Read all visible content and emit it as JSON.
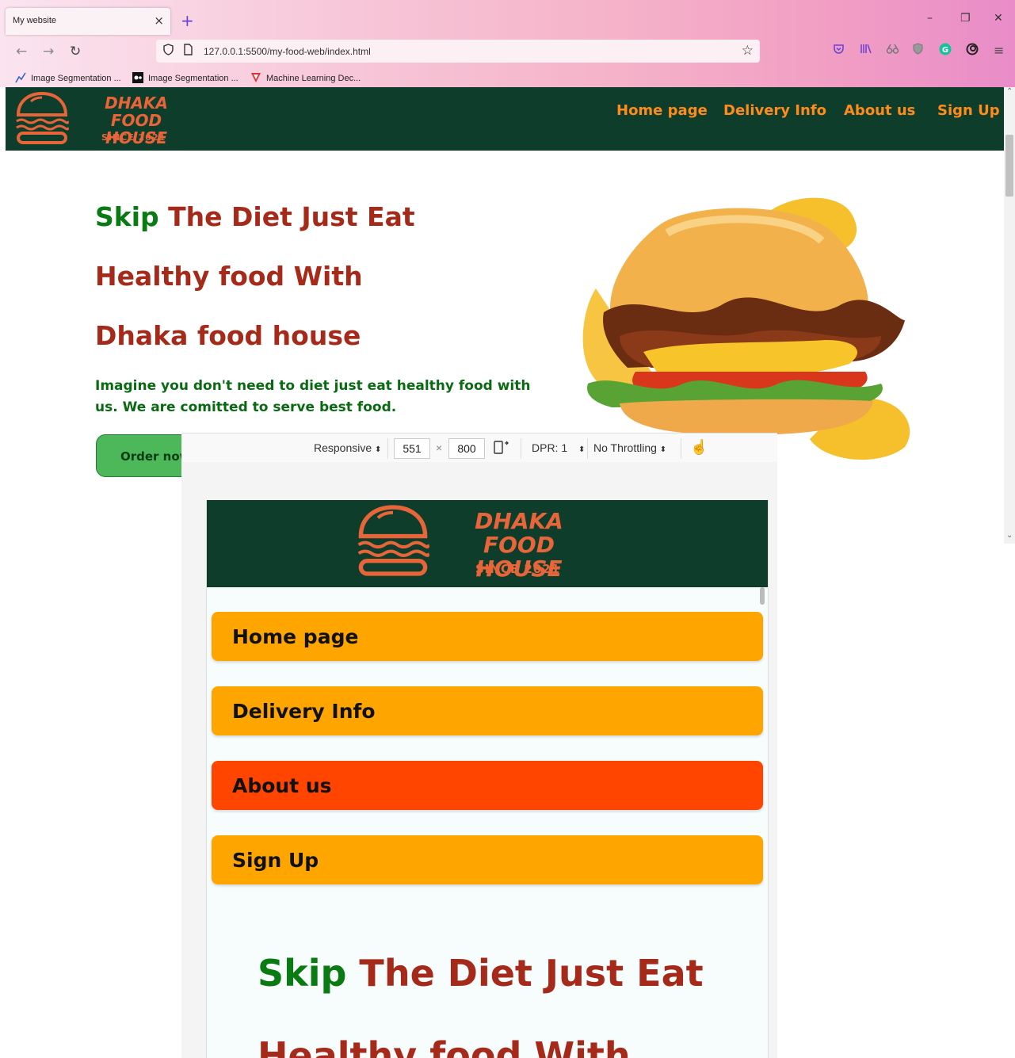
{
  "browser": {
    "tab_title": "My website",
    "tab_close": "×",
    "new_tab": "+",
    "window_controls": {
      "minimize": "–",
      "restore": "❐",
      "close": "✕"
    },
    "url": "127.0.0.1:5500/my-food-web/index.html",
    "bookmarks": [
      {
        "label": "Image Segmentation ...",
        "icon": "chart-line-icon"
      },
      {
        "label": "Image Segmentation ...",
        "icon": "medium-logo-icon"
      },
      {
        "label": "Machine Learning Dec...",
        "icon": "v-logo-icon"
      }
    ]
  },
  "site": {
    "logo": {
      "line1": "DHAKA FOOD",
      "line2": "HOUSE",
      "since": "SINCE 2021"
    },
    "nav": [
      "Home page",
      "Delivery Info",
      "About us",
      "Sign Up"
    ],
    "hero": {
      "heading1_green": "Skip",
      "heading1_rest": " The Diet Just Eat",
      "heading2": "Healthy food With",
      "heading3": "Dhaka food house",
      "paragraph": "Imagine you don't need to diet just eat healthy food with us. We are comitted to serve best food.",
      "order_button": "Order now"
    },
    "colors": {
      "header_bg": "#0f3d2b",
      "logo_orange": "#e8653a",
      "nav_orange": "#ff8c1a",
      "heading_red": "#a52a1a",
      "heading_green": "#0a7a12",
      "button_green": "#4cb85a",
      "menu_orange": "#ffa500",
      "menu_active": "#ff4500"
    }
  },
  "devtools": {
    "device": "Responsive",
    "width": "551",
    "times": "×",
    "height": "800",
    "dpr": "DPR: 1",
    "throttling": "No Throttling"
  },
  "mobile": {
    "menu": [
      {
        "label": "Home page",
        "active": false
      },
      {
        "label": "Delivery Info",
        "active": false
      },
      {
        "label": "About us",
        "active": true
      },
      {
        "label": "Sign Up",
        "active": false
      }
    ],
    "hero_heading1_green": "Skip",
    "hero_heading1_rest": " The Diet Just Eat",
    "hero_heading2": "Healthy food With"
  }
}
